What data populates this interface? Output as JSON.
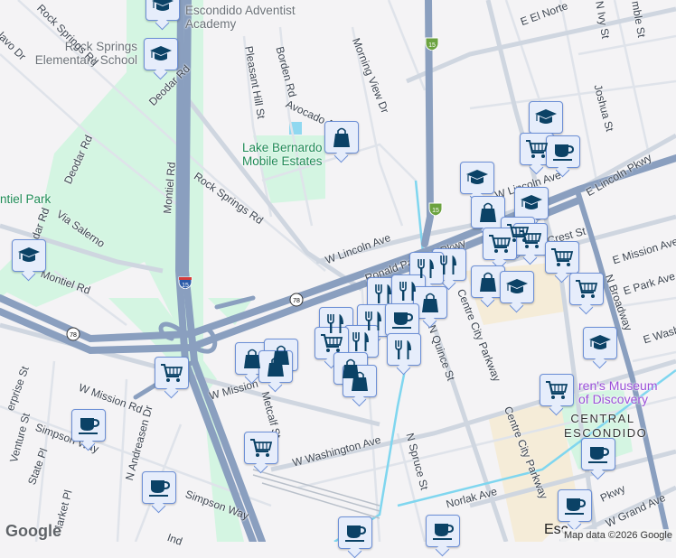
{
  "map": {
    "places": {
      "academy": "Escondido Adventist Academy",
      "elementary": "Rock Springs Elementary School",
      "lake": "Lake Bernardo Mobile Estates",
      "park": "ntiel Park",
      "museum": "ren's Museum of Discovery",
      "district": "CENTRAL ESCONDIDO",
      "esc": "Esc"
    },
    "streets": {
      "rock_springs_top": "Rock Springs Rd",
      "salvo": "alavo Dr",
      "deodar1": "Deodar Rd",
      "deodar2": "Deodar Rd",
      "deodar3": "dar Rd",
      "montiel": "Montiel Rd",
      "montiel2": "Montiel Rd",
      "via_salerno": "Via Salerno",
      "rock_springs": "Rock Springs Rd",
      "pleasant_hill": "Pleasant Hill St",
      "borden": "Borden Rd",
      "avocado": "Avocado A",
      "morning_view": "Morning View Dr",
      "el_norte": "E El Norte",
      "ivy": "N Ivy St",
      "rumble": "mble St",
      "joshua": "Joshua St",
      "w_lincoln": "W Lincoln Ave",
      "w_lincoln2": "W Lincoln Ave",
      "e_lincoln": "E Lincoln Pkwy",
      "ronald": "Ronald Packard Pkwy",
      "crest": "Crest St",
      "e_mission": "E Mission Ave",
      "e_park": "E Park Ave",
      "broadway": "N Broadway",
      "e_wash": "E Wash",
      "quince": "N Quince St",
      "centre1": "Centre City Parkway",
      "centre2": "Centre City Parkway",
      "spruce": "N Spruce St",
      "norlak": "Norlak Ave",
      "pkwy": "Pkwy",
      "grand": "W Grand Ave",
      "w_mission": "W Mission Rd",
      "w_mission2": "W Mission",
      "metcalf": "Metcalf St",
      "w_washington": "W Washington Ave",
      "enterprise": "erprise St",
      "venture": "Venture St",
      "simpson": "Simpson Way",
      "simpson2": "Simpson Way",
      "state": "State Pl",
      "andreasen": "N Andreasen Dr",
      "market": "Market Pl",
      "ind": "Ind"
    },
    "shields": {
      "i15": "15",
      "sr78": "78"
    },
    "markers": [
      "school",
      "school",
      "shopping-bag",
      "school",
      "school",
      "cart",
      "coffee",
      "school",
      "shopping-bag",
      "school",
      "cart",
      "cart",
      "cart",
      "cart",
      "restaurant",
      "restaurant",
      "shopping-bag",
      "school",
      "cart",
      "restaurant",
      "restaurant",
      "shopping-bag",
      "restaurant",
      "restaurant",
      "coffee",
      "restaurant",
      "cart",
      "restaurant",
      "shopping-bag",
      "shopping-bag",
      "shopping-bag",
      "cart",
      "shopping-bag",
      "shopping-bag",
      "school",
      "cart",
      "coffee",
      "cart",
      "coffee",
      "coffee",
      "coffee",
      "coffee",
      "coffee"
    ],
    "logo": "Google",
    "attribution": "Map data ©2026 Google",
    "colors": {
      "freeway": "#8a9fbf",
      "park": "#d4f5e2",
      "water": "#7fd6ef",
      "marker_icon": "#0b4266"
    }
  }
}
